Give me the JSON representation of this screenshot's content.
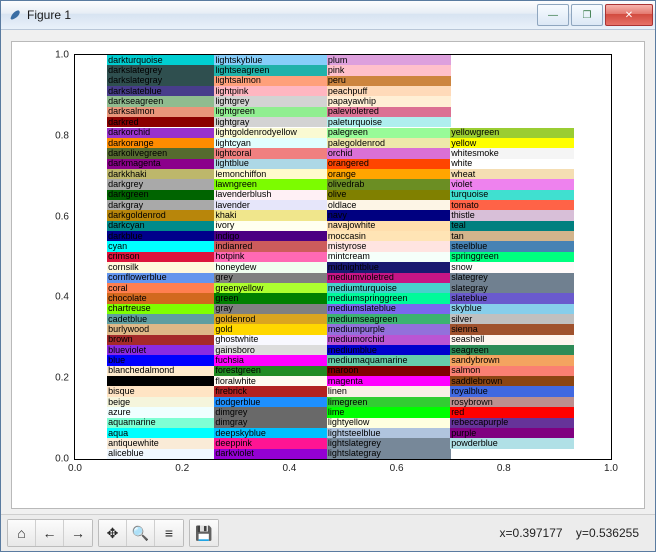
{
  "window": {
    "title": "Figure 1",
    "icon": "feather-icon"
  },
  "controls": {
    "minimize": "—",
    "maximize": "❐",
    "close": "✕"
  },
  "toolbar": {
    "home": "⌂",
    "back": "←",
    "forward": "→",
    "pan": "✥",
    "zoom": "🔍",
    "subplots": "≡",
    "save": "💾"
  },
  "status": {
    "x_label": "x=",
    "x_value": "0.397177",
    "y_label": "y=",
    "y_value": "0.536255"
  },
  "chart_data": {
    "type": "heatmap",
    "title": "",
    "xlabel": "",
    "ylabel": "",
    "xlim": [
      0.0,
      1.0
    ],
    "ylim": [
      0.0,
      1.0
    ],
    "xticks": [
      0.0,
      0.2,
      0.4,
      0.6,
      0.8,
      1.0
    ],
    "yticks": [
      0.0,
      0.2,
      0.4,
      0.6,
      0.8,
      1.0
    ],
    "row_height": 0.028,
    "row_count": 36,
    "col_x": [
      0.06,
      0.26,
      0.47,
      0.7
    ],
    "col_w": [
      0.2,
      0.21,
      0.23,
      0.23
    ],
    "cells": [
      [
        {
          "name": "darkturquoise",
          "hex": "#00ced1"
        },
        {
          "name": "lightskyblue",
          "hex": "#87cefa"
        },
        {
          "name": "plum",
          "hex": "#dda0dd"
        },
        null
      ],
      [
        {
          "name": "darkslategrey",
          "hex": "#2f4f4f"
        },
        {
          "name": "lightseagreen",
          "hex": "#20b2aa"
        },
        {
          "name": "pink",
          "hex": "#ffc0cb"
        },
        null
      ],
      [
        {
          "name": "darkslategray",
          "hex": "#2f4f4f"
        },
        {
          "name": "lightsalmon",
          "hex": "#ffa07a"
        },
        {
          "name": "peru",
          "hex": "#cd853f"
        },
        null
      ],
      [
        {
          "name": "darkslateblue",
          "hex": "#483d8b"
        },
        {
          "name": "lightpink",
          "hex": "#ffb6c1"
        },
        {
          "name": "peachpuff",
          "hex": "#ffdab9"
        },
        null
      ],
      [
        {
          "name": "darkseagreen",
          "hex": "#8fbc8f"
        },
        {
          "name": "lightgrey",
          "hex": "#d3d3d3"
        },
        {
          "name": "papayawhip",
          "hex": "#ffefd5"
        },
        null
      ],
      [
        {
          "name": "darksalmon",
          "hex": "#e9967a"
        },
        {
          "name": "lightgreen",
          "hex": "#90ee90"
        },
        {
          "name": "palevioletred",
          "hex": "#db7093"
        },
        null
      ],
      [
        {
          "name": "darkred",
          "hex": "#8b0000"
        },
        {
          "name": "lightgray",
          "hex": "#d3d3d3"
        },
        {
          "name": "paleturquoise",
          "hex": "#afeeee"
        },
        null
      ],
      [
        {
          "name": "darkorchid",
          "hex": "#9932cc"
        },
        {
          "name": "lightgoldenrodyellow",
          "hex": "#fafad2"
        },
        {
          "name": "palegreen",
          "hex": "#98fb98"
        },
        {
          "name": "yellowgreen",
          "hex": "#9acd32"
        }
      ],
      [
        {
          "name": "darkorange",
          "hex": "#ff8c00"
        },
        {
          "name": "lightcyan",
          "hex": "#e0ffff"
        },
        {
          "name": "palegoldenrod",
          "hex": "#eee8aa"
        },
        {
          "name": "yellow",
          "hex": "#ffff00"
        }
      ],
      [
        {
          "name": "darkolivegreen",
          "hex": "#556b2f"
        },
        {
          "name": "lightcoral",
          "hex": "#f08080"
        },
        {
          "name": "orchid",
          "hex": "#da70d6"
        },
        {
          "name": "whitesmoke",
          "hex": "#f5f5f5"
        }
      ],
      [
        {
          "name": "darkmagenta",
          "hex": "#8b008b"
        },
        {
          "name": "lightblue",
          "hex": "#add8e6"
        },
        {
          "name": "orangered",
          "hex": "#ff4500"
        },
        {
          "name": "white",
          "hex": "#ffffff"
        }
      ],
      [
        {
          "name": "darkkhaki",
          "hex": "#bdb76b"
        },
        {
          "name": "lemonchiffon",
          "hex": "#fffacd"
        },
        {
          "name": "orange",
          "hex": "#ffa500"
        },
        {
          "name": "wheat",
          "hex": "#f5deb3"
        }
      ],
      [
        {
          "name": "darkgrey",
          "hex": "#a9a9a9"
        },
        {
          "name": "lawngreen",
          "hex": "#7cfc00"
        },
        {
          "name": "olivedrab",
          "hex": "#6b8e23"
        },
        {
          "name": "violet",
          "hex": "#ee82ee"
        }
      ],
      [
        {
          "name": "darkgreen",
          "hex": "#006400"
        },
        {
          "name": "lavenderblush",
          "hex": "#fff0f5"
        },
        {
          "name": "olive",
          "hex": "#808000"
        },
        {
          "name": "turquoise",
          "hex": "#40e0d0"
        }
      ],
      [
        {
          "name": "darkgray",
          "hex": "#a9a9a9"
        },
        {
          "name": "lavender",
          "hex": "#e6e6fa"
        },
        {
          "name": "oldlace",
          "hex": "#fdf5e6"
        },
        {
          "name": "tomato",
          "hex": "#ff6347"
        }
      ],
      [
        {
          "name": "darkgoldenrod",
          "hex": "#b8860b"
        },
        {
          "name": "khaki",
          "hex": "#f0e68c"
        },
        {
          "name": "navy",
          "hex": "#000080"
        },
        {
          "name": "thistle",
          "hex": "#d8bfd8"
        }
      ],
      [
        {
          "name": "darkcyan",
          "hex": "#008b8b"
        },
        {
          "name": "ivory",
          "hex": "#fffff0"
        },
        {
          "name": "navajowhite",
          "hex": "#ffdead"
        },
        {
          "name": "teal",
          "hex": "#008080"
        }
      ],
      [
        {
          "name": "darkblue",
          "hex": "#00008b"
        },
        {
          "name": "indigo",
          "hex": "#4b0082"
        },
        {
          "name": "moccasin",
          "hex": "#ffe4b5"
        },
        {
          "name": "tan",
          "hex": "#d2b48c"
        }
      ],
      [
        {
          "name": "cyan",
          "hex": "#00ffff"
        },
        {
          "name": "indianred",
          "hex": "#cd5c5c"
        },
        {
          "name": "mistyrose",
          "hex": "#ffe4e1"
        },
        {
          "name": "steelblue",
          "hex": "#4682b4"
        }
      ],
      [
        {
          "name": "crimson",
          "hex": "#dc143c"
        },
        {
          "name": "hotpink",
          "hex": "#ff69b4"
        },
        {
          "name": "mintcream",
          "hex": "#f5fffa"
        },
        {
          "name": "springgreen",
          "hex": "#00ff7f"
        }
      ],
      [
        {
          "name": "cornsilk",
          "hex": "#fff8dc"
        },
        {
          "name": "honeydew",
          "hex": "#f0fff0"
        },
        {
          "name": "midnightblue",
          "hex": "#191970"
        },
        {
          "name": "snow",
          "hex": "#fffafa"
        }
      ],
      [
        {
          "name": "cornflowerblue",
          "hex": "#6495ed"
        },
        {
          "name": "grey",
          "hex": "#808080"
        },
        {
          "name": "mediumvioletred",
          "hex": "#c71585"
        },
        {
          "name": "slategrey",
          "hex": "#708090"
        }
      ],
      [
        {
          "name": "coral",
          "hex": "#ff7f50"
        },
        {
          "name": "greenyellow",
          "hex": "#adff2f"
        },
        {
          "name": "mediumturquoise",
          "hex": "#48d1cc"
        },
        {
          "name": "slategray",
          "hex": "#708090"
        }
      ],
      [
        {
          "name": "chocolate",
          "hex": "#d2691e"
        },
        {
          "name": "green",
          "hex": "#008000"
        },
        {
          "name": "mediumspringgreen",
          "hex": "#00fa9a"
        },
        {
          "name": "slateblue",
          "hex": "#6a5acd"
        }
      ],
      [
        {
          "name": "chartreuse",
          "hex": "#7fff00"
        },
        {
          "name": "gray",
          "hex": "#808080"
        },
        {
          "name": "mediumslateblue",
          "hex": "#7b68ee"
        },
        {
          "name": "skyblue",
          "hex": "#87ceeb"
        }
      ],
      [
        {
          "name": "cadetblue",
          "hex": "#5f9ea0"
        },
        {
          "name": "goldenrod",
          "hex": "#daa520"
        },
        {
          "name": "mediumseagreen",
          "hex": "#3cb371"
        },
        {
          "name": "silver",
          "hex": "#c0c0c0"
        }
      ],
      [
        {
          "name": "burlywood",
          "hex": "#deb887"
        },
        {
          "name": "gold",
          "hex": "#ffd700"
        },
        {
          "name": "mediumpurple",
          "hex": "#9370db"
        },
        {
          "name": "sienna",
          "hex": "#a0522d"
        }
      ],
      [
        {
          "name": "brown",
          "hex": "#a52a2a"
        },
        {
          "name": "ghostwhite",
          "hex": "#f8f8ff"
        },
        {
          "name": "mediumorchid",
          "hex": "#ba55d3"
        },
        {
          "name": "seashell",
          "hex": "#fff5ee"
        }
      ],
      [
        {
          "name": "blueviolet",
          "hex": "#8a2be2"
        },
        {
          "name": "gainsboro",
          "hex": "#dcdcdc"
        },
        {
          "name": "mediumblue",
          "hex": "#0000cd"
        },
        {
          "name": "seagreen",
          "hex": "#2e8b57"
        }
      ],
      [
        {
          "name": "blue",
          "hex": "#0000ff"
        },
        {
          "name": "fuchsia",
          "hex": "#ff00ff"
        },
        {
          "name": "mediumaquamarine",
          "hex": "#66cdaa"
        },
        {
          "name": "sandybrown",
          "hex": "#f4a460"
        }
      ],
      [
        {
          "name": "blanchedalmond",
          "hex": "#ffebcd"
        },
        {
          "name": "forestgreen",
          "hex": "#228b22"
        },
        {
          "name": "maroon",
          "hex": "#800000"
        },
        {
          "name": "salmon",
          "hex": "#fa8072"
        }
      ],
      [
        {
          "name": "black",
          "hex": "#000000"
        },
        {
          "name": "floralwhite",
          "hex": "#fffaf0"
        },
        {
          "name": "magenta",
          "hex": "#ff00ff"
        },
        {
          "name": "saddlebrown",
          "hex": "#8b4513"
        }
      ],
      [
        {
          "name": "bisque",
          "hex": "#ffe4c4"
        },
        {
          "name": "firebrick",
          "hex": "#b22222"
        },
        {
          "name": "linen",
          "hex": "#faf0e6"
        },
        {
          "name": "royalblue",
          "hex": "#4169e1"
        }
      ],
      [
        {
          "name": "beige",
          "hex": "#f5f5dc"
        },
        {
          "name": "dodgerblue",
          "hex": "#1e90ff"
        },
        {
          "name": "limegreen",
          "hex": "#32cd32"
        },
        {
          "name": "rosybrown",
          "hex": "#bc8f8f"
        }
      ],
      [
        {
          "name": "azure",
          "hex": "#f0ffff"
        },
        {
          "name": "dimgrey",
          "hex": "#696969"
        },
        {
          "name": "lime",
          "hex": "#00ff00"
        },
        {
          "name": "red",
          "hex": "#ff0000"
        }
      ],
      [
        {
          "name": "aquamarine",
          "hex": "#7fffd4"
        },
        {
          "name": "dimgray",
          "hex": "#696969"
        },
        {
          "name": "lightyellow",
          "hex": "#ffffe0"
        },
        {
          "name": "rebeccapurple",
          "hex": "#663399"
        }
      ],
      [
        {
          "name": "aqua",
          "hex": "#00ffff"
        },
        {
          "name": "deepskyblue",
          "hex": "#00bfff"
        },
        {
          "name": "lightsteelblue",
          "hex": "#b0c4de"
        },
        {
          "name": "purple",
          "hex": "#800080"
        }
      ],
      [
        {
          "name": "antiquewhite",
          "hex": "#faebd7"
        },
        {
          "name": "deeppink",
          "hex": "#ff1493"
        },
        {
          "name": "lightslategrey",
          "hex": "#778899"
        },
        {
          "name": "powderblue",
          "hex": "#b0e0e6"
        }
      ],
      [
        {
          "name": "aliceblue",
          "hex": "#f0f8ff"
        },
        {
          "name": "darkviolet",
          "hex": "#9400d3"
        },
        {
          "name": "lightslategray",
          "hex": "#778899"
        },
        null
      ]
    ]
  }
}
